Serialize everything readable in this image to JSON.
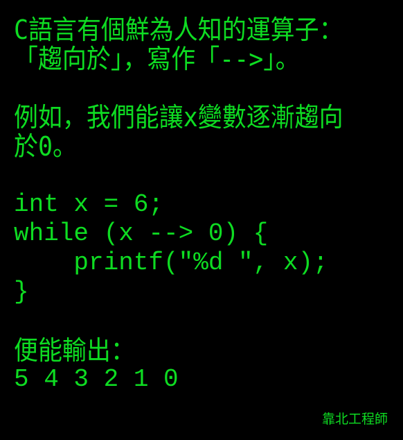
{
  "text_color": "#0edc22",
  "background_color": "#000000",
  "intro": {
    "line1": "C語言有個鮮為人知的運算子：",
    "line2": "「趨向於」，寫作「-->」。"
  },
  "example": {
    "line1": "例如，我們能讓x變數逐漸趨向",
    "line2": "於0。"
  },
  "code": {
    "line1": "int x = 6;",
    "line2": "while (x --> 0) {",
    "line3": "    printf(\"%d \", x);",
    "line4": "}"
  },
  "output": {
    "label": "便能輸出：",
    "values": "5 4 3 2 1 0"
  },
  "footer": {
    "author": "靠北工程師"
  }
}
